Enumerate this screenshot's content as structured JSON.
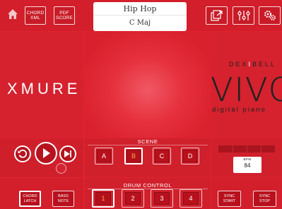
{
  "header": {
    "chord_xml": [
      "CHORD",
      "XML"
    ],
    "pdf_score": [
      "PDF",
      "SCORE"
    ],
    "song_title": "Hip Hop",
    "song_key": "C Maj"
  },
  "icons": {
    "home": "home-icon",
    "export": "export-icon",
    "mixer": "mixer-icon",
    "settings": "gears-icon"
  },
  "left_panel": {
    "title": "XMURE"
  },
  "right_panel": {
    "brand_pre": "DEX",
    "brand_hl": "I",
    "brand_post": "BELL",
    "model": "VIVO",
    "subtitle": "digital piano"
  },
  "scene": {
    "label": "SCENE",
    "buttons": [
      "A",
      "B",
      "C",
      "D"
    ],
    "selected": "B"
  },
  "drum_control": {
    "label": "DRUM CONTROL",
    "buttons": [
      "1",
      "2",
      "3",
      "4"
    ],
    "selected": "1"
  },
  "tempo": {
    "bpm_label": "BPM",
    "bpm_value": "84"
  },
  "bottom_left": {
    "chord_latch": [
      "CHORD",
      "LATCH"
    ],
    "bass_note": [
      "BASS",
      "NOTE"
    ]
  },
  "bottom_right": {
    "sync_start": [
      "SYNC",
      "START"
    ],
    "sync_stop": [
      "SYNC",
      "STOP"
    ]
  },
  "colors": {
    "brand_red": "#e0222f",
    "selected_accent": "#f0b040"
  }
}
